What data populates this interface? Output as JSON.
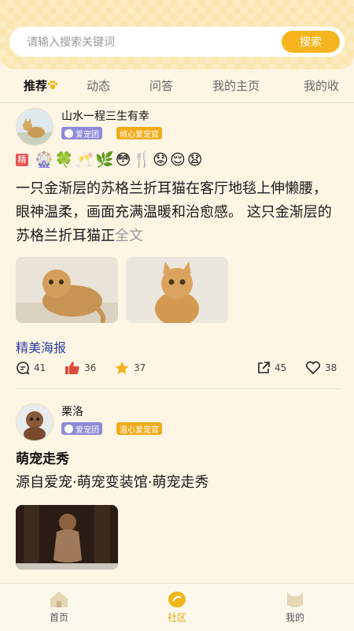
{
  "search": {
    "placeholder": "请输入搜索关键词",
    "button_label": "搜索"
  },
  "tabs": [
    {
      "label": "推荐",
      "active": true
    },
    {
      "label": "动态"
    },
    {
      "label": "问答"
    },
    {
      "label": "我的主页"
    },
    {
      "label": "我的收"
    }
  ],
  "posts": [
    {
      "username": "山水一程三生有幸",
      "badges": [
        "爱宠团",
        "倾心爱宠官"
      ],
      "emoji_row": "🎡🍀🥂🌿😳🍴😟😌😧",
      "jing_label": "精",
      "text": "一只金渐层的苏格兰折耳猫在客厅地毯上伸懒腰，眼神温柔，画面充满温暖和治愈感。 这只金渐层的苏格兰折耳猫正",
      "more_label": "全文",
      "link": "精美海报",
      "stats": {
        "comments": "41",
        "likes": "36",
        "stars": "37",
        "shares": "45",
        "hearts": "38"
      }
    },
    {
      "username": "栗洛",
      "badges": [
        "爱宠团",
        "温心爱宠官"
      ],
      "title": "萌宠走秀",
      "text": "源自爱宠·萌宠变装馆·萌宠走秀"
    }
  ],
  "nav": [
    {
      "label": "首页"
    },
    {
      "label": "社区",
      "active": true
    },
    {
      "label": "我的"
    }
  ],
  "colors": {
    "accent": "#f6b51e",
    "header": "#fae6b1",
    "link": "#2f3fa8",
    "like": "#e04a3a",
    "star": "#f2b21b"
  }
}
